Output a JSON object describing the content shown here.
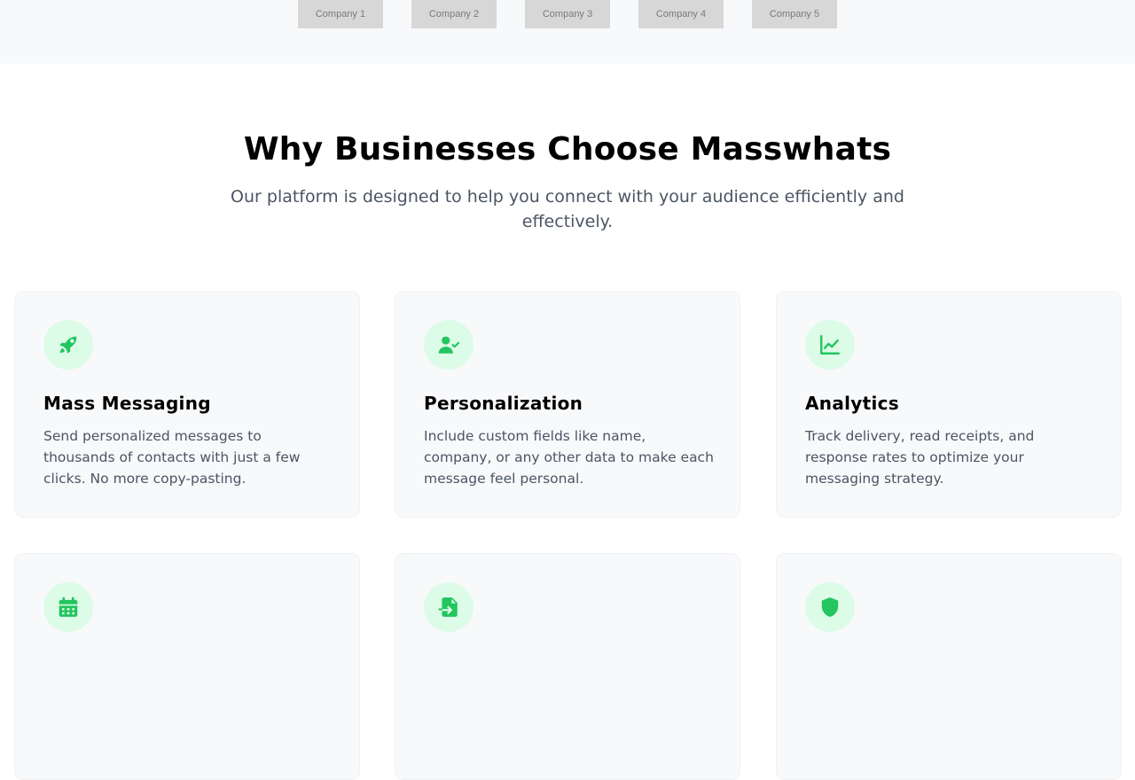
{
  "trusted_by": {
    "logos": [
      "Company 1",
      "Company 2",
      "Company 3",
      "Company 4",
      "Company 5"
    ]
  },
  "features": {
    "title": "Why Businesses Choose Masswhats",
    "subtitle": "Our platform is designed to help you connect with your audience efficiently and effectively.",
    "accent_color": "#22c55e",
    "icon_bg_color": "#dcfce7",
    "cards": [
      {
        "icon": "rocket-icon",
        "title": "Mass Messaging",
        "description": "Send personalized messages to thousands of contacts with just a few clicks. No more copy-pasting."
      },
      {
        "icon": "user-check-icon",
        "title": "Personalization",
        "description": "Include custom fields like name, company, or any other data to make each message feel personal."
      },
      {
        "icon": "chart-line-icon",
        "title": "Analytics",
        "description": "Track delivery, read receipts, and response rates to optimize your messaging strategy."
      },
      {
        "icon": "calendar-icon"
      },
      {
        "icon": "file-import-icon"
      },
      {
        "icon": "shield-icon"
      }
    ]
  }
}
